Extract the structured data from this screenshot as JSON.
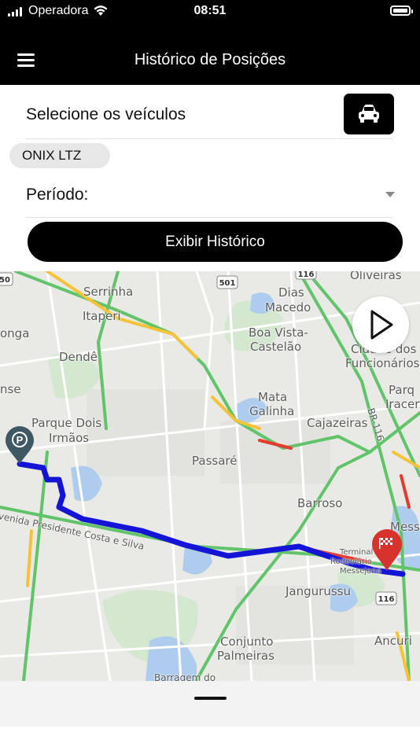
{
  "status_bar": {
    "carrier": "Operadora",
    "time": "08:51",
    "icons": [
      "signal-icon",
      "wifi-icon",
      "battery-icon"
    ]
  },
  "header": {
    "title": "Histórico de Posições",
    "menu_icon": "hamburger-menu-icon"
  },
  "vehicles": {
    "label": "Selecione os veículos",
    "button_icon": "car-icon",
    "selected": [
      "ONIX LTZ"
    ]
  },
  "period": {
    "label": "Período:",
    "value": ""
  },
  "actions": {
    "show_history": "Exibir Histórico"
  },
  "map": {
    "place_labels": [
      "Serrinha",
      "Itaperi",
      "Dendê",
      "onga",
      "Parque Dois",
      "Irmãos",
      "nse",
      "Passaré",
      "Dias",
      "Macedo",
      "Boa Vista-",
      "Castelão",
      "Mata",
      "Galinha",
      "Cajazeiras",
      "Oliveiras",
      "Cidade dos",
      "Funcionários",
      "Parq",
      "Iracer",
      "BR-116",
      "Barroso",
      "Messe",
      "Terminal",
      "Rodoviário",
      "Messejana",
      "Jangurussu",
      "Conjunto",
      "Palmeiras",
      "Ancuri",
      "Barragem do",
      "venida Presidente Costa e Silva"
    ],
    "road_shields": [
      "501",
      "116",
      "116",
      "50"
    ],
    "start_marker_icon": "parking-pin-icon",
    "end_marker_icon": "checkered-flag-pin-icon",
    "play_icon": "play-icon",
    "route_color": "#1414d6",
    "start_marker_color": "#3f5866",
    "end_marker_color": "#d8322c"
  },
  "colors": {
    "header_bg": "#000000",
    "button_bg": "#000000",
    "chip_bg": "#e7e7e7"
  }
}
